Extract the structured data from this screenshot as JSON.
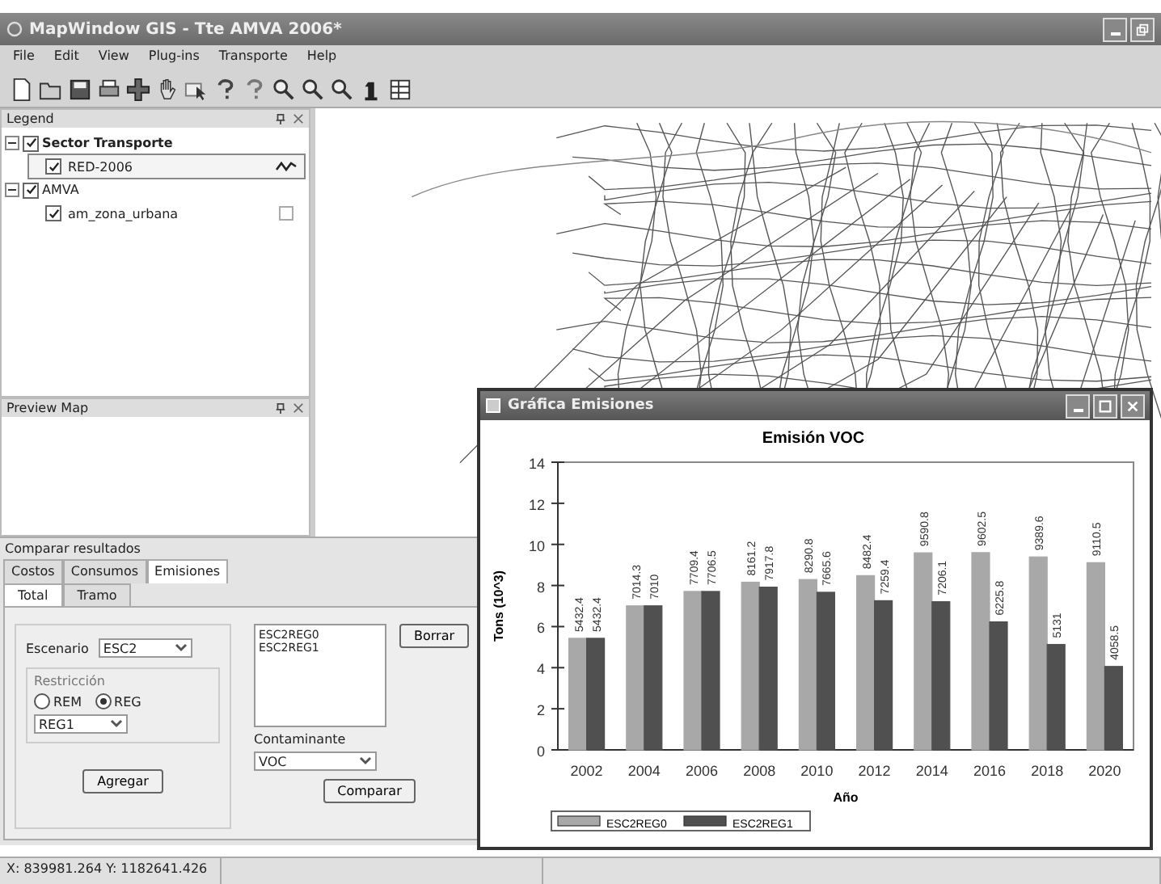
{
  "window": {
    "title": "MapWindow GIS - Tte AMVA 2006*"
  },
  "menu": [
    "File",
    "Edit",
    "View",
    "Plug-ins",
    "Transporte",
    "Help"
  ],
  "legend": {
    "title": "Legend",
    "groups": [
      {
        "name": "Sector Transporte",
        "checked": true,
        "expanded": true,
        "selected": true,
        "layers": [
          {
            "name": "RED-2006",
            "checked": true,
            "kind": "line",
            "selected": true
          }
        ]
      },
      {
        "name": "AMVA",
        "checked": true,
        "expanded": true,
        "selected": false,
        "layers": [
          {
            "name": "am_zona_urbana",
            "checked": true,
            "kind": "polygon",
            "selected": false
          }
        ]
      }
    ]
  },
  "preview_map": {
    "title": "Preview Map"
  },
  "compare": {
    "title": "Comparar resultados",
    "tabs": [
      {
        "label": "Costos",
        "selected": false
      },
      {
        "label": "Consumos",
        "selected": false
      },
      {
        "label": "Emisiones",
        "selected": true
      }
    ],
    "subtabs": [
      {
        "label": "Total",
        "selected": true
      },
      {
        "label": "Tramo",
        "selected": false
      }
    ],
    "escenario_label": "Escenario",
    "escenario_value": "ESC2",
    "restriccion_label": "Restricción",
    "radios": [
      {
        "label": "REM",
        "selected": false
      },
      {
        "label": "REG",
        "selected": true
      }
    ],
    "region_value": "REG1",
    "add_button": "Agregar",
    "list_items": [
      "ESC2REG0",
      "ESC2REG1"
    ],
    "delete_button": "Borrar",
    "contaminante_label": "Contaminante",
    "contaminante_value": "VOC",
    "compare_button": "Comparar"
  },
  "status_bar": {
    "coordinates": "X: 839981.264   Y: 1182641.426"
  },
  "chart_window": {
    "title": "Gráfica Emisiones",
    "chart_data": {
      "type": "bar",
      "title": "Emisión VOC",
      "xlabel": "Año",
      "ylabel": "Tons (10^3)",
      "categories": [
        "2002",
        "2004",
        "2006",
        "2008",
        "2010",
        "2012",
        "2014",
        "2016",
        "2018",
        "2020"
      ],
      "series": [
        {
          "name": "ESC2REG0",
          "color": "#a8a8a8",
          "values": [
            5.43,
            7.01,
            7.71,
            8.16,
            8.29,
            8.48,
            9.59,
            9.6,
            9.39,
            9.11
          ]
        },
        {
          "name": "ESC2REG1",
          "color": "#505050",
          "values": [
            5.43,
            7.01,
            7.71,
            7.92,
            7.67,
            7.26,
            7.21,
            6.23,
            5.13,
            4.06
          ]
        }
      ],
      "ylim": [
        0,
        14
      ],
      "yticks": [
        0,
        2,
        4,
        6,
        8,
        10,
        12,
        14
      ],
      "annotations": [
        {
          "x": "2002",
          "y": 5.43,
          "text": "5432.4"
        },
        {
          "x": "2004",
          "y": 7.01,
          "text": "7014.3"
        },
        {
          "x": "2006",
          "y": 7.71,
          "text": "7709.4"
        },
        {
          "x": "2008",
          "y": 8.16,
          "text": "8161.2"
        },
        {
          "x": "2010",
          "y": 8.29,
          "text": "8290.8"
        },
        {
          "x": "2012",
          "y": 8.48,
          "text": "8482.4"
        },
        {
          "x": "2014",
          "y": 9.59,
          "text": "9590.8"
        },
        {
          "x": "2016",
          "y": 9.6,
          "text": "9602.5"
        },
        {
          "x": "2018",
          "y": 9.39,
          "text": "9389.6"
        },
        {
          "x": "2020",
          "y": 9.11,
          "text": "9110.5"
        },
        {
          "x": "2002",
          "y": 5.43,
          "text": "5432.4"
        },
        {
          "x": "2004",
          "y": 7.01,
          "text": "7010"
        },
        {
          "x": "2006",
          "y": 7.71,
          "text": "7706.5"
        },
        {
          "x": "2008",
          "y": 7.92,
          "text": "7917.8"
        },
        {
          "x": "2010",
          "y": 7.67,
          "text": "7665.6"
        },
        {
          "x": "2012",
          "y": 7.26,
          "text": "7259.4"
        },
        {
          "x": "2014",
          "y": 7.21,
          "text": "7206.1"
        },
        {
          "x": "2016",
          "y": 6.23,
          "text": "6225.8"
        },
        {
          "x": "2018",
          "y": 5.13,
          "text": "5131"
        },
        {
          "x": "2020",
          "y": 4.06,
          "text": "4058.5"
        }
      ],
      "legend": "bottom-left"
    }
  }
}
